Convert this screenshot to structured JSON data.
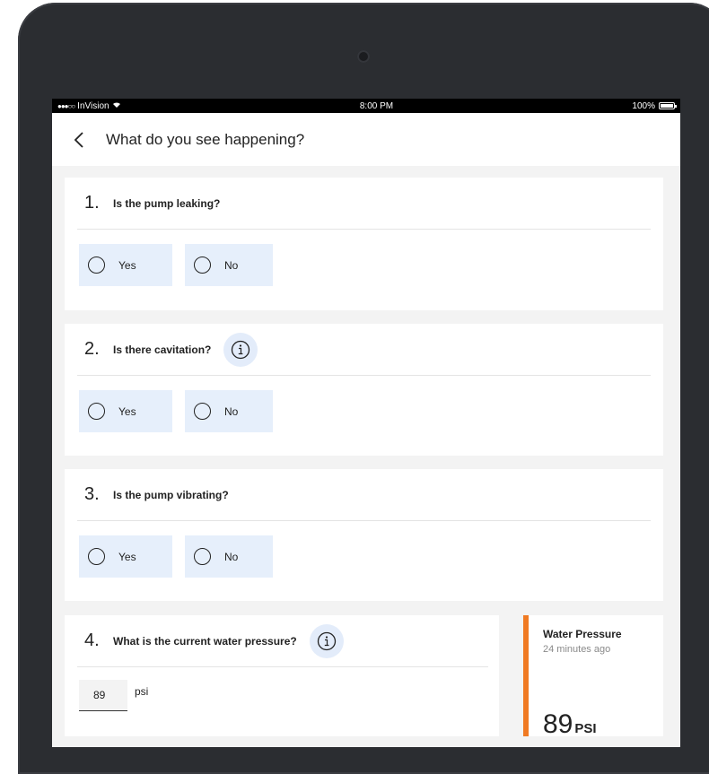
{
  "status_bar": {
    "carrier": "InVision",
    "time": "8:00 PM",
    "battery": "100%"
  },
  "nav": {
    "title": "What do you see happening?"
  },
  "questions": [
    {
      "number": "1.",
      "text": "Is the pump leaking?",
      "has_info": false,
      "options": [
        "Yes",
        "No"
      ]
    },
    {
      "number": "2.",
      "text": "Is there cavitation?",
      "has_info": true,
      "options": [
        "Yes",
        "No"
      ]
    },
    {
      "number": "3.",
      "text": "Is the pump vibrating?",
      "has_info": false,
      "options": [
        "Yes",
        "No"
      ]
    },
    {
      "number": "4.",
      "text": "What is the current water pressure?",
      "has_info": true,
      "input_value": "89",
      "unit": "psi"
    }
  ],
  "metric": {
    "title": "Water Pressure",
    "time": "24 minutes ago",
    "value": "89",
    "unit": "PSI"
  },
  "colors": {
    "accent": "#f07a23",
    "option_bg": "#e6effb",
    "info_bg": "#e3ecfa"
  },
  "icons": {
    "back": "chevron-left-icon",
    "info": "info-icon",
    "wifi": "wifi-icon",
    "battery": "battery-icon"
  }
}
